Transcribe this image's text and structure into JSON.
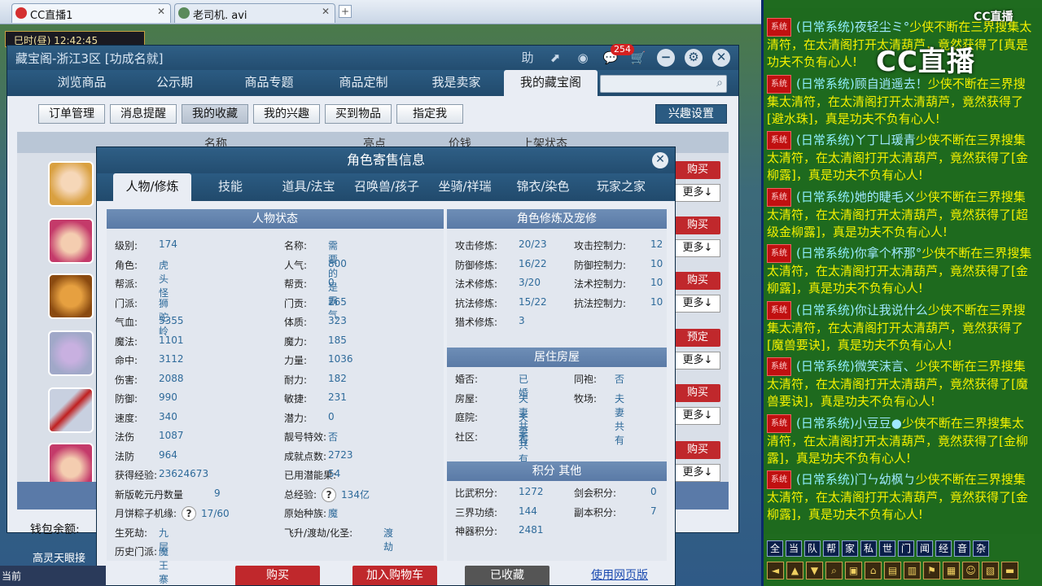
{
  "browser": {
    "tabs": [
      {
        "label": "CC直播1",
        "close": "✕"
      },
      {
        "label": "老司机. avi",
        "close": "✕"
      }
    ],
    "newtab": "+"
  },
  "hud": {
    "time": "巳时(昼)  12:42:45"
  },
  "window": {
    "title": "藏宝阁-浙江3区 [功成名就]",
    "icons": {
      "help": "助",
      "share": "⬈",
      "stop": "◉",
      "chat": "💬",
      "chat_badge": "254",
      "cart": "🛒",
      "min": "−",
      "settings": "⚙",
      "close": "✕"
    },
    "nav": [
      "浏览商品",
      "公示期",
      "商品专题",
      "商品定制",
      "我是卖家",
      "我的藏宝阁"
    ],
    "search_placeholder": "",
    "sub": [
      "订单管理",
      "消息提醒",
      "我的收藏",
      "我的兴趣",
      "买到物品",
      "指定我"
    ],
    "interest_settings": "兴趣设置",
    "list_headers": [
      "名称",
      "亮点",
      "价钱",
      "上架状态"
    ],
    "row_buttons": [
      "购买",
      "更多↓",
      "购买",
      "更多↓",
      "购买",
      "更多↓",
      "预定",
      "更多↓",
      "购买",
      "更多↓",
      "购买",
      "更多↓"
    ],
    "wallet_label": "钱包余额:"
  },
  "dialog": {
    "title": "角色寄售信息",
    "close": "✕",
    "tabs": [
      "人物/修炼",
      "技能",
      "道具/法宝",
      "召唤兽/孩子",
      "坐骑/祥瑞",
      "锦衣/染色",
      "玩家之家"
    ],
    "left_header": "人物状态",
    "left_col1": [
      {
        "k": "级别:",
        "v": "174"
      },
      {
        "k": "角色:",
        "v": "虎头怪"
      },
      {
        "k": "帮派:",
        "v": ""
      },
      {
        "k": "门派:",
        "v": "狮驼岭"
      },
      {
        "k": "气血:",
        "v": "5355"
      },
      {
        "k": "魔法:",
        "v": "1101"
      },
      {
        "k": "命中:",
        "v": "3112"
      },
      {
        "k": "伤害:",
        "v": "2088"
      },
      {
        "k": "防御:",
        "v": "990"
      },
      {
        "k": "速度:",
        "v": "340"
      },
      {
        "k": "法伤",
        "v": "1087"
      },
      {
        "k": "法防",
        "v": "964"
      },
      {
        "k": "获得经验:",
        "v": "23624673"
      },
      {
        "k": "新版乾元丹数量",
        "v": "9"
      },
      {
        "k": "月饼粽子机缘:",
        "v": "17/60"
      },
      {
        "k": "生死劫:",
        "v": "九层"
      },
      {
        "k": "历史门派:",
        "v": "魔王寨"
      }
    ],
    "left_col2": [
      {
        "k": "名称:",
        "v": "需要的是霸气"
      },
      {
        "k": "人气:",
        "v": "800"
      },
      {
        "k": "帮贡:",
        "v": "0"
      },
      {
        "k": "门贡:",
        "v": "265"
      },
      {
        "k": "体质:",
        "v": "323"
      },
      {
        "k": "魔力:",
        "v": "185"
      },
      {
        "k": "力量:",
        "v": "1036"
      },
      {
        "k": "耐力:",
        "v": "182"
      },
      {
        "k": "敏捷:",
        "v": "231"
      },
      {
        "k": "潜力:",
        "v": "0"
      },
      {
        "k": "靓号特效:",
        "v": "否"
      },
      {
        "k": "成就点数:",
        "v": "2723"
      },
      {
        "k": "已用潜能果:",
        "v": "54"
      },
      {
        "k": "总经验:",
        "v": "134亿"
      },
      {
        "k": "原始种族:",
        "v": "魔"
      },
      {
        "k": "飞升/渡劫/化圣:",
        "v": "渡劫"
      }
    ],
    "help_mark": "?",
    "right_header1": "角色修炼及宠修",
    "cultivation": [
      {
        "k": "攻击修炼:",
        "v": "20/23",
        "k2": "攻击控制力:",
        "v2": "12"
      },
      {
        "k": "防御修炼:",
        "v": "16/22",
        "k2": "防御控制力:",
        "v2": "10"
      },
      {
        "k": "法术修炼:",
        "v": "3/20",
        "k2": "法术控制力:",
        "v2": "10"
      },
      {
        "k": "抗法修炼:",
        "v": "15/22",
        "k2": "抗法控制力:",
        "v2": "10"
      },
      {
        "k": "猎术修炼:",
        "v": "3",
        "k2": "",
        "v2": ""
      }
    ],
    "right_header2": "居住房屋",
    "house": [
      {
        "k": "婚否:",
        "v": "已婚",
        "k2": "同袍:",
        "v2": "否"
      },
      {
        "k": "房屋:",
        "v": "夫妻共有",
        "k2": "牧场:",
        "v2": "夫妻共有"
      },
      {
        "k": "庭院:",
        "v": "夫妻共有",
        "k2": "",
        "v2": ""
      },
      {
        "k": "社区:",
        "v": "无",
        "k2": "",
        "v2": ""
      }
    ],
    "right_header3": "积分 其他",
    "score": [
      {
        "k": "比武积分:",
        "v": "1272",
        "k2": "剑会积分:",
        "v2": "0"
      },
      {
        "k": "三界功绩:",
        "v": "144",
        "k2": "副本积分:",
        "v2": "7"
      },
      {
        "k": "神器积分:",
        "v": "2481",
        "k2": "",
        "v2": ""
      }
    ],
    "footer": [
      "购买",
      "加入购物车",
      "已收藏",
      "使用网页版"
    ]
  },
  "chat": {
    "logo": "CC直播",
    "logo_small": "CC直播",
    "tag": "系统",
    "messages": [
      {
        "sys": "(日常系统)",
        "name": "夜轻尘ミ°",
        "text": "少侠不断在三界搜集太清符，在太清阁打开太清葫芦，竟然获得了",
        "item": "[",
        "end": "真是功夫不负有心人!"
      },
      {
        "sys": "(日常系统)",
        "name": "顾自逍遥去！",
        "text": "少侠不断在三界搜集太清符，在太清阁打开太清葫芦，竟然获得了",
        "item": "[避水珠]",
        "end": "，真是功夫不负有心人!"
      },
      {
        "sys": "(日常系统)",
        "name": "ㄚ丁ㄩ瑗青",
        "text": "少侠不断在三界搜集太清符，在太清阁打开太清葫芦，竟然获得了",
        "item": "[金柳露]",
        "end": "，真是功夫不负有心人!"
      },
      {
        "sys": "(日常系统)",
        "name": "她的睫毛ㄨ",
        "text": "少侠不断在三界搜集太清符，在太清阁打开太清葫芦，竟然获得了",
        "item": "[超级金柳露]",
        "end": "，真是功夫不负有心人!"
      },
      {
        "sys": "(日常系统)",
        "name": "你拿个杯那°",
        "text": "少侠不断在三界搜集太清符，在太清阁打开太清葫芦，竟然获得了",
        "item": "[金柳露]",
        "end": "，真是功夫不负有心人!"
      },
      {
        "sys": "(日常系统)",
        "name": "你让我说什么",
        "text": "少侠不断在三界搜集太清符，在太清阁打开太清葫芦，竟然获得了",
        "item": "[魔兽要诀]",
        "end": "，真是功夫不负有心人!"
      },
      {
        "sys": "(日常系统)",
        "name": "微笑沫言、",
        "text": "少侠不断在三界搜集太清符，在太清阁打开太清葫芦，竟然获得了",
        "item": "[魔兽要诀]",
        "end": "，真是功夫不负有心人!"
      },
      {
        "sys": "(日常系统)",
        "name": "小豆豆●",
        "text": "少侠不断在三界搜集太清符，在太清阁打开太清葫芦，竟然获得了",
        "item": "[金柳露]",
        "end": "，真是功夫不负有心人!"
      },
      {
        "sys": "(日常系统)",
        "name": "门ㄣ幼枫ㄅ",
        "text": "少侠不断在三界搜集太清符，在太清阁打开太清葫芦，竟然获得了",
        "item": "[金柳露]",
        "end": "，真是功夫不负有心人!"
      }
    ],
    "channels": [
      "全",
      "当",
      "队",
      "帮",
      "家",
      "私",
      "世",
      "门",
      "闻",
      "经",
      "音",
      "杂"
    ],
    "tools": [
      "◄",
      "▲",
      "▼",
      "⌕",
      "▣",
      "⌂",
      "▤",
      "▥",
      "⚑",
      "▦",
      "☺",
      "▧",
      "▬"
    ]
  },
  "bottom": {
    "labels": [
      "当前",
      "高灵天眼接"
    ]
  }
}
